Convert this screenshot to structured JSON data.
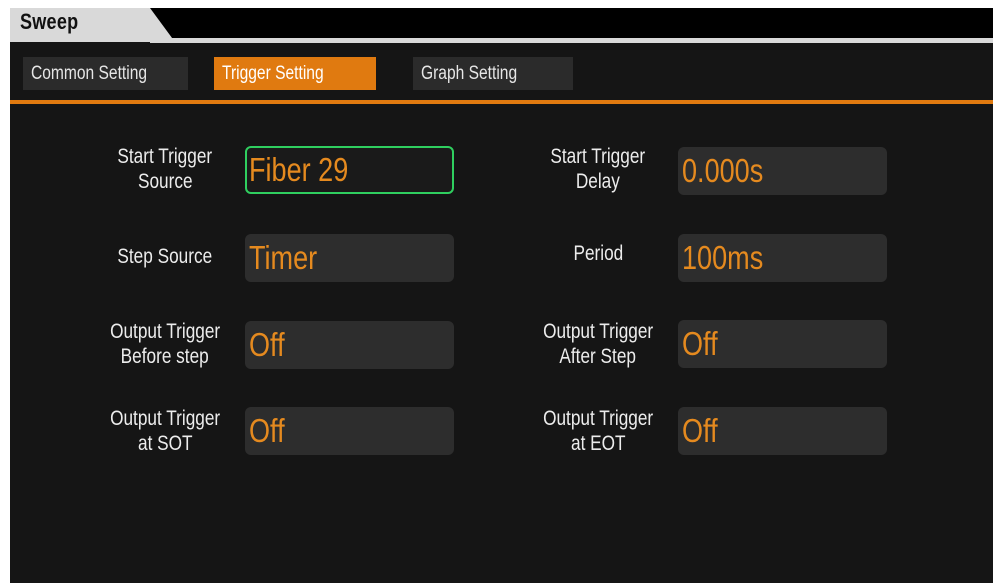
{
  "title": "Sweep",
  "tabs": [
    {
      "label": "Common Setting",
      "active": false
    },
    {
      "label": "Trigger Setting",
      "active": true
    },
    {
      "label": "Graph Setting",
      "active": false
    }
  ],
  "fields": {
    "start_trigger_source": {
      "label_line1": "Start Trigger",
      "label_line2": "Source",
      "value": "Fiber 29"
    },
    "start_trigger_delay": {
      "label_line1": "Start Trigger",
      "label_line2": "Delay",
      "value": "0.000s"
    },
    "step_source": {
      "label_line1": "Step Source",
      "value": "Timer"
    },
    "period": {
      "label_line1": "Period",
      "value": "100ms"
    },
    "output_trigger_before_step": {
      "label_line1": "Output Trigger",
      "label_line2": "Before step",
      "value": "Off"
    },
    "output_trigger_after_step": {
      "label_line1": "Output Trigger",
      "label_line2": "After Step",
      "value": "Off"
    },
    "output_trigger_at_sot": {
      "label_line1": "Output Trigger",
      "label_line2": "at SOT",
      "value": "Off"
    },
    "output_trigger_at_eot": {
      "label_line1": "Output Trigger",
      "label_line2": "at EOT",
      "value": "Off"
    }
  },
  "colors": {
    "accent": "#e07a10",
    "value_text": "#e58a1f",
    "focus_border": "#2fcf5f",
    "background": "#151515"
  }
}
